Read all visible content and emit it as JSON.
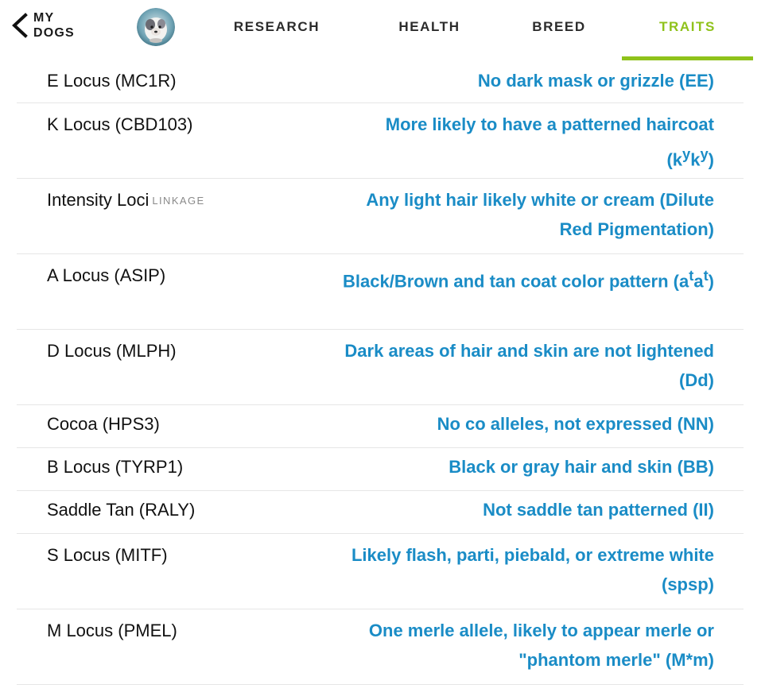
{
  "nav": {
    "back_label": "MY DOGS",
    "avatar_label": "dog profile photo",
    "tabs": [
      {
        "label": "RESEARCH",
        "active": false
      },
      {
        "label": "HEALTH",
        "active": false
      },
      {
        "label": "BREED",
        "active": false
      },
      {
        "label": "TRAITS",
        "active": true
      }
    ],
    "active_color": "#8fc21b"
  },
  "colors": {
    "trait_value": "#1a8cc6",
    "trait_name": "#111111",
    "divider": "#e6e6e6"
  },
  "traits": [
    {
      "name": "E Locus (MC1R)",
      "value": "No dark mask or grizzle (EE)"
    },
    {
      "name": "K Locus (CBD103)",
      "value_text": "More likely to have a patterned haircoat (",
      "value_base1": "k",
      "value_sup1": "y",
      "value_base2": "k",
      "value_sup2": "y",
      "value_end": ")"
    },
    {
      "name": "Intensity Loci",
      "tag": "LINKAGE",
      "value": "Any light hair likely white or cream (Dilute Red Pigmentation)"
    },
    {
      "name": "A Locus (ASIP)",
      "value_text": "Black/Brown and tan coat color pattern (",
      "value_base1": "a",
      "value_sup1": "t",
      "value_base2": "a",
      "value_sup2": "t",
      "value_end": ")"
    },
    {
      "name": "D Locus (MLPH)",
      "value": "Dark areas of hair and skin are not lightened (Dd)"
    },
    {
      "name": "Cocoa (HPS3)",
      "value": "No co alleles, not expressed (NN)"
    },
    {
      "name": "B Locus (TYRP1)",
      "value": "Black or gray hair and skin (BB)"
    },
    {
      "name": "Saddle Tan (RALY)",
      "value": "Not saddle tan patterned (II)"
    },
    {
      "name": "S Locus (MITF)",
      "value": "Likely flash, parti, piebald, or extreme white (spsp)"
    },
    {
      "name": "M Locus (PMEL)",
      "value": "One merle allele, likely to appear merle or \"phantom merle\" (M*m)"
    }
  ]
}
